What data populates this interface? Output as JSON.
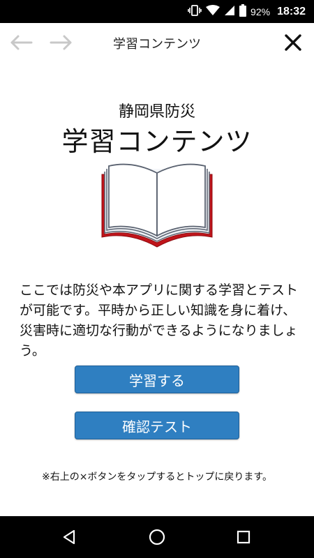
{
  "status_bar": {
    "battery": "92%",
    "time": "18:32"
  },
  "nav": {
    "title": "学習コンテンツ",
    "back_icon": "arrow-left-icon",
    "forward_icon": "arrow-right-icon",
    "close_icon": "close-icon"
  },
  "hero": {
    "subtitle": "静岡県防災",
    "title": "学習コンテンツ",
    "illustration": "open-book-icon"
  },
  "description": "ここでは防災や本アプリに関する学習とテストが可能です。平時から正しい知識を身に着け、災害時に適切な行動ができるようになりましょう。",
  "buttons": {
    "learn": "学習する",
    "test": "確認テスト"
  },
  "note": "※右上の×ボタンをタップするとトップに戻ります。",
  "colors": {
    "button": "#2f7fc1",
    "book_cover": "#c0141a",
    "inactive_arrow": "#c8c8c8"
  }
}
